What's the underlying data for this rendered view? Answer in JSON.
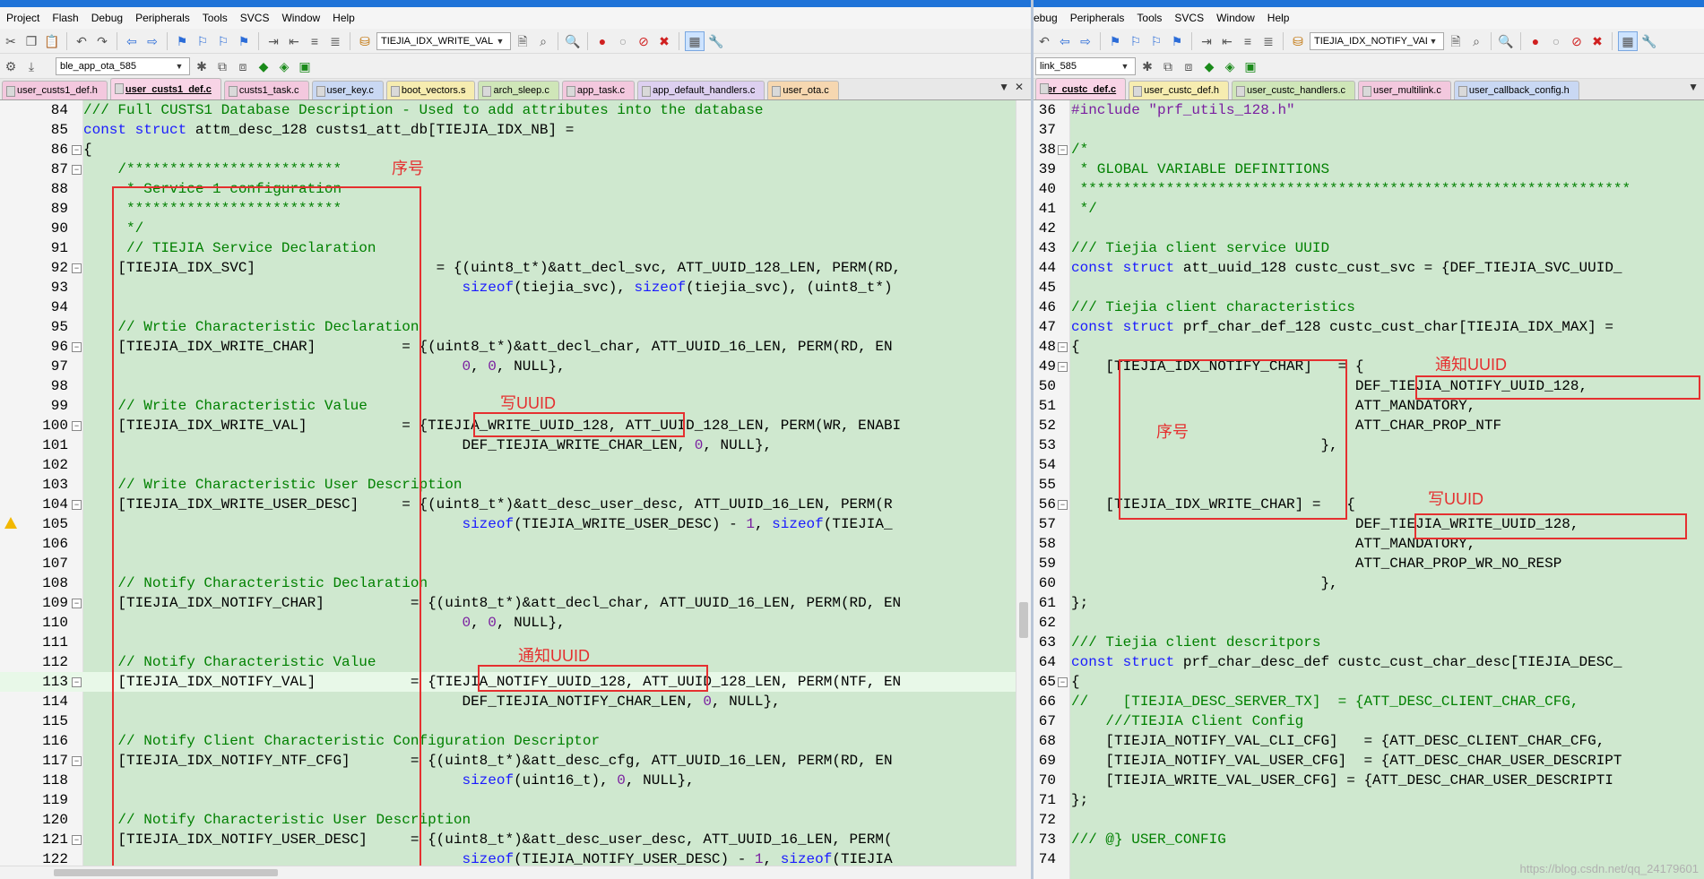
{
  "left": {
    "menu": [
      "Project",
      "Flash",
      "Debug",
      "Peripherals",
      "Tools",
      "SVCS",
      "Window",
      "Help"
    ],
    "toolbar1_select": "TIEJIA_IDX_WRITE_VAL",
    "toolbar2_select": "ble_app_ota_585",
    "tabs": [
      "user_custs1_def.h",
      "user_custs1_def.c",
      "custs1_task.c",
      "user_key.c",
      "boot_vectors.s",
      "arch_sleep.c",
      "app_task.c",
      "app_default_handlers.c",
      "user_ota.c"
    ],
    "lines": [
      {
        "n": "84",
        "code": "/// Full CUSTS1 Database Description - Used to add attributes into the database"
      },
      {
        "n": "85",
        "code": "const struct attm_desc_128 custs1_att_db[TIEJIA_IDX_NB] ="
      },
      {
        "n": "86",
        "code": "{"
      },
      {
        "n": "87",
        "code": "    /*************************"
      },
      {
        "n": "88",
        "code": "     * Service 1 configuration"
      },
      {
        "n": "89",
        "code": "     *************************"
      },
      {
        "n": "90",
        "code": "     */"
      },
      {
        "n": "91",
        "code": "     // TIEJIA Service Declaration"
      },
      {
        "n": "92",
        "code": "    [TIEJIA_IDX_SVC]                     = {(uint8_t*)&att_decl_svc, ATT_UUID_128_LEN, PERM(RD,"
      },
      {
        "n": "93",
        "code": "                                            sizeof(tiejia_svc), sizeof(tiejia_svc), (uint8_t*)"
      },
      {
        "n": "94",
        "code": ""
      },
      {
        "n": "95",
        "code": "    // Wrtie Characteristic Declaration"
      },
      {
        "n": "96",
        "code": "    [TIEJIA_IDX_WRITE_CHAR]          = {(uint8_t*)&att_decl_char, ATT_UUID_16_LEN, PERM(RD, EN"
      },
      {
        "n": "97",
        "code": "                                            0, 0, NULL},"
      },
      {
        "n": "98",
        "code": ""
      },
      {
        "n": "99",
        "code": "    // Write Characteristic Value"
      },
      {
        "n": "100",
        "code": "    [TIEJIA_IDX_WRITE_VAL]           = {TIEJIA_WRITE_UUID_128, ATT_UUID_128_LEN, PERM(WR, ENABI"
      },
      {
        "n": "101",
        "code": "                                            DEF_TIEJIA_WRITE_CHAR_LEN, 0, NULL},"
      },
      {
        "n": "102",
        "code": ""
      },
      {
        "n": "103",
        "code": "    // Write Characteristic User Description"
      },
      {
        "n": "104",
        "code": "    [TIEJIA_IDX_WRITE_USER_DESC]     = {(uint8_t*)&att_desc_user_desc, ATT_UUID_16_LEN, PERM(R"
      },
      {
        "n": "105",
        "code": "                                            sizeof(TIEJIA_WRITE_USER_DESC) - 1, sizeof(TIEJIA_"
      },
      {
        "n": "106",
        "code": ""
      },
      {
        "n": "107",
        "code": ""
      },
      {
        "n": "108",
        "code": "    // Notify Characteristic Declaration"
      },
      {
        "n": "109",
        "code": "    [TIEJIA_IDX_NOTIFY_CHAR]          = {(uint8_t*)&att_decl_char, ATT_UUID_16_LEN, PERM(RD, EN"
      },
      {
        "n": "110",
        "code": "                                            0, 0, NULL},"
      },
      {
        "n": "111",
        "code": ""
      },
      {
        "n": "112",
        "code": "    // Notify Characteristic Value"
      },
      {
        "n": "113",
        "code": "    [TIEJIA_IDX_NOTIFY_VAL]           = {TIEJIA_NOTIFY_UUID_128, ATT_UUID_128_LEN, PERM(NTF, EN"
      },
      {
        "n": "114",
        "code": "                                            DEF_TIEJIA_NOTIFY_CHAR_LEN, 0, NULL},"
      },
      {
        "n": "115",
        "code": ""
      },
      {
        "n": "116",
        "code": "    // Notify Client Characteristic Configuration Descriptor"
      },
      {
        "n": "117",
        "code": "    [TIEJIA_IDX_NOTIFY_NTF_CFG]       = {(uint8_t*)&att_desc_cfg, ATT_UUID_16_LEN, PERM(RD, EN"
      },
      {
        "n": "118",
        "code": "                                            sizeof(uint16_t), 0, NULL},"
      },
      {
        "n": "119",
        "code": ""
      },
      {
        "n": "120",
        "code": "    // Notify Characteristic User Description"
      },
      {
        "n": "121",
        "code": "    [TIEJIA_IDX_NOTIFY_USER_DESC]     = {(uint8_t*)&att_desc_user_desc, ATT_UUID_16_LEN, PERM("
      },
      {
        "n": "122",
        "code": "                                            sizeof(TIEJIA_NOTIFY_USER_DESC) - 1, sizeof(TIEJIA"
      }
    ],
    "annotations": {
      "seq": "序号",
      "write_uuid": "写UUID",
      "notify_uuid": "通知UUID"
    }
  },
  "right": {
    "menu": [
      "ebug",
      "Peripherals",
      "Tools",
      "SVCS",
      "Window",
      "Help"
    ],
    "toolbar1_select": "TIEJIA_IDX_NOTIFY_VAL",
    "toolbar2_select": "link_585",
    "tabs": [
      "ser_custc_def.c",
      "user_custc_def.h",
      "user_custc_handlers.c",
      "user_multilink.c",
      "user_callback_config.h"
    ],
    "lines": [
      {
        "n": "36",
        "code": "#include \"prf_utils_128.h\""
      },
      {
        "n": "37",
        "code": ""
      },
      {
        "n": "38",
        "code": "/*"
      },
      {
        "n": "39",
        "code": " * GLOBAL VARIABLE DEFINITIONS"
      },
      {
        "n": "40",
        "code": " ****************************************************************"
      },
      {
        "n": "41",
        "code": " */"
      },
      {
        "n": "42",
        "code": ""
      },
      {
        "n": "43",
        "code": "/// Tiejia client service UUID"
      },
      {
        "n": "44",
        "code": "const struct att_uuid_128 custc_cust_svc = {DEF_TIEJIA_SVC_UUID_"
      },
      {
        "n": "45",
        "code": ""
      },
      {
        "n": "46",
        "code": "/// Tiejia client characteristics"
      },
      {
        "n": "47",
        "code": "const struct prf_char_def_128 custc_cust_char[TIEJIA_IDX_MAX] ="
      },
      {
        "n": "48",
        "code": "{"
      },
      {
        "n": "49",
        "code": "    [TIEJIA_IDX_NOTIFY_CHAR]   = {"
      },
      {
        "n": "50",
        "code": "                                 DEF_TIEJIA_NOTIFY_UUID_128,"
      },
      {
        "n": "51",
        "code": "                                 ATT_MANDATORY,"
      },
      {
        "n": "52",
        "code": "                                 ATT_CHAR_PROP_NTF"
      },
      {
        "n": "53",
        "code": "                             },"
      },
      {
        "n": "54",
        "code": ""
      },
      {
        "n": "55",
        "code": ""
      },
      {
        "n": "56",
        "code": "    [TIEJIA_IDX_WRITE_CHAR] =   {"
      },
      {
        "n": "57",
        "code": "                                 DEF_TIEJIA_WRITE_UUID_128,"
      },
      {
        "n": "58",
        "code": "                                 ATT_MANDATORY,"
      },
      {
        "n": "59",
        "code": "                                 ATT_CHAR_PROP_WR_NO_RESP"
      },
      {
        "n": "60",
        "code": "                             },"
      },
      {
        "n": "61",
        "code": "};"
      },
      {
        "n": "62",
        "code": ""
      },
      {
        "n": "63",
        "code": "/// Tiejia client descritpors"
      },
      {
        "n": "64",
        "code": "const struct prf_char_desc_def custc_cust_char_desc[TIEJIA_DESC_"
      },
      {
        "n": "65",
        "code": "{"
      },
      {
        "n": "66",
        "code": "//    [TIEJIA_DESC_SERVER_TX]  = {ATT_DESC_CLIENT_CHAR_CFG,"
      },
      {
        "n": "67",
        "code": "    ///TIEJIA Client Config"
      },
      {
        "n": "68",
        "code": "    [TIEJIA_NOTIFY_VAL_CLI_CFG]   = {ATT_DESC_CLIENT_CHAR_CFG,"
      },
      {
        "n": "69",
        "code": "    [TIEJIA_NOTIFY_VAL_USER_CFG]  = {ATT_DESC_CHAR_USER_DESCRIPT"
      },
      {
        "n": "70",
        "code": "    [TIEJIA_WRITE_VAL_USER_CFG] = {ATT_DESC_CHAR_USER_DESCRIPTI"
      },
      {
        "n": "71",
        "code": "};"
      },
      {
        "n": "72",
        "code": ""
      },
      {
        "n": "73",
        "code": "/// @} USER_CONFIG"
      },
      {
        "n": "74",
        "code": ""
      }
    ],
    "annotations": {
      "notify_uuid": "通知UUID",
      "seq": "序号",
      "write_uuid": "写UUID"
    }
  },
  "watermark": "https://blog.csdn.net/qq_24179601",
  "colors": {
    "editor_bg": "#cfe8cf",
    "keyword": "#1a1aff",
    "comment": "#008000",
    "number": "#7a1ea0",
    "annotation": "#e53030"
  }
}
